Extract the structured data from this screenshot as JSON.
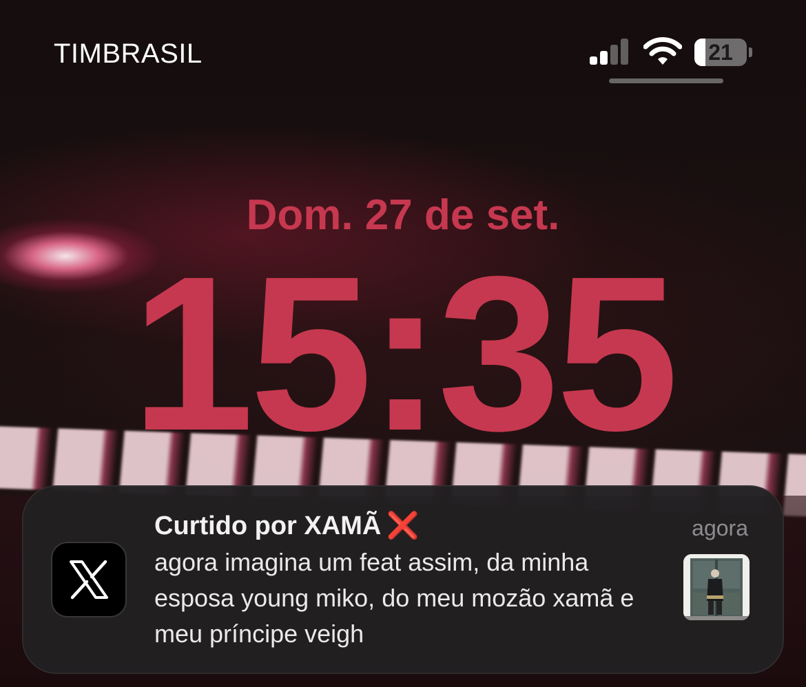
{
  "status_bar": {
    "carrier": "TIMBRASIL",
    "signal_bars_active": 2,
    "signal_bars_total": 4,
    "battery_level": "21",
    "battery_fraction": 0.21
  },
  "lock_screen": {
    "date": "Dom. 27 de set.",
    "time": "15:35",
    "accent_color": "#c6384f"
  },
  "notification": {
    "app_icon": "x-logo-icon",
    "title": "Curtido por XAMÃ",
    "title_emoji": "❌",
    "timestamp": "agora",
    "body": "agora imagina um feat assim, da minha esposa young miko, do meu mozão xamã e meu príncipe veigh",
    "thumbnail": "photo-thumbnail"
  }
}
